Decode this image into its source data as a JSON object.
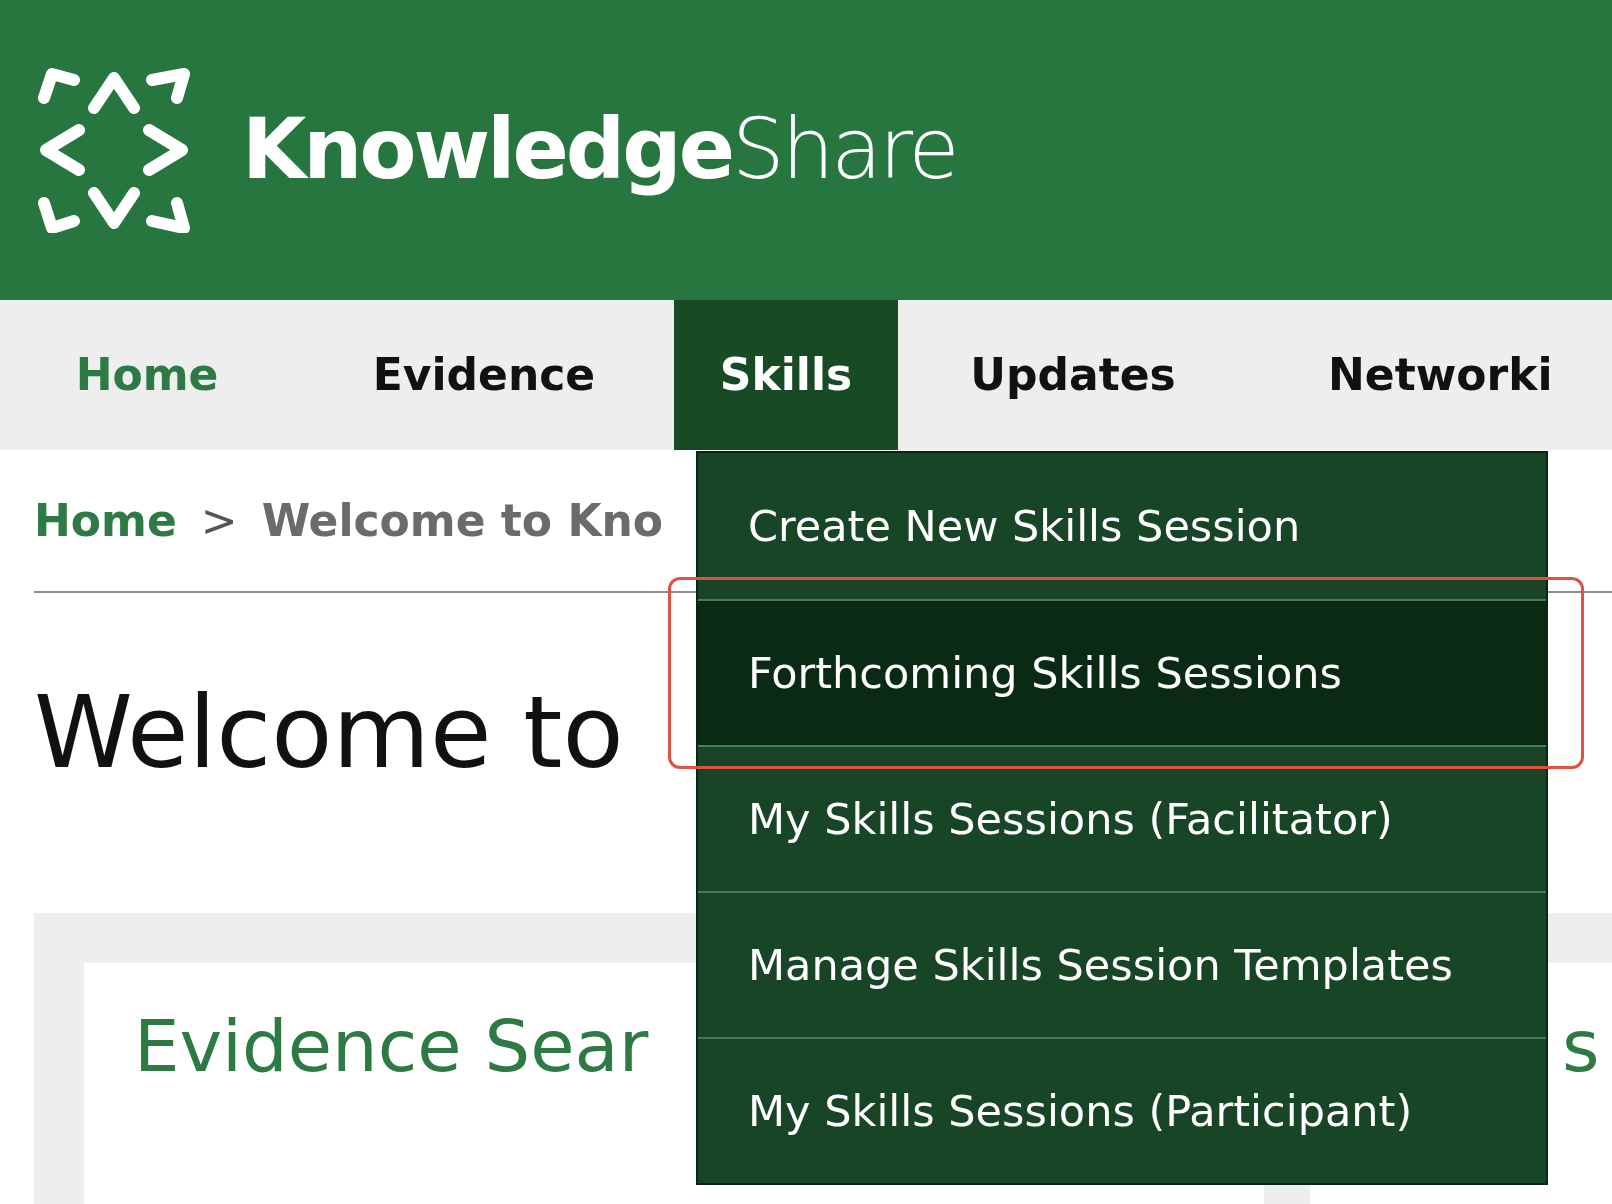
{
  "header": {
    "logo_bold": "Knowledge",
    "logo_light": "Share"
  },
  "nav": {
    "tabs": [
      {
        "label": "Home",
        "selected": false,
        "kind": "home"
      },
      {
        "label": "Evidence",
        "selected": false,
        "kind": "plain"
      },
      {
        "label": "Skills",
        "selected": true,
        "kind": "plain"
      },
      {
        "label": "Updates",
        "selected": false,
        "kind": "plain"
      },
      {
        "label": "Networki",
        "selected": false,
        "kind": "plain"
      }
    ]
  },
  "dropdown": {
    "items": [
      {
        "label": "Create New Skills Session",
        "highlighted": false
      },
      {
        "label": "Forthcoming Skills Sessions",
        "highlighted": true
      },
      {
        "label": "My Skills Sessions (Facilitator)",
        "highlighted": false
      },
      {
        "label": "Manage Skills Session Templates",
        "highlighted": false
      },
      {
        "label": "My Skills Sessions (Participant)",
        "highlighted": false
      }
    ]
  },
  "breadcrumb": [
    "Home",
    ">",
    "Welcome to Kno"
  ],
  "page_title": "Welcome to",
  "cards": [
    {
      "title": "Evidence Sear"
    },
    {
      "title": "s"
    }
  ]
}
